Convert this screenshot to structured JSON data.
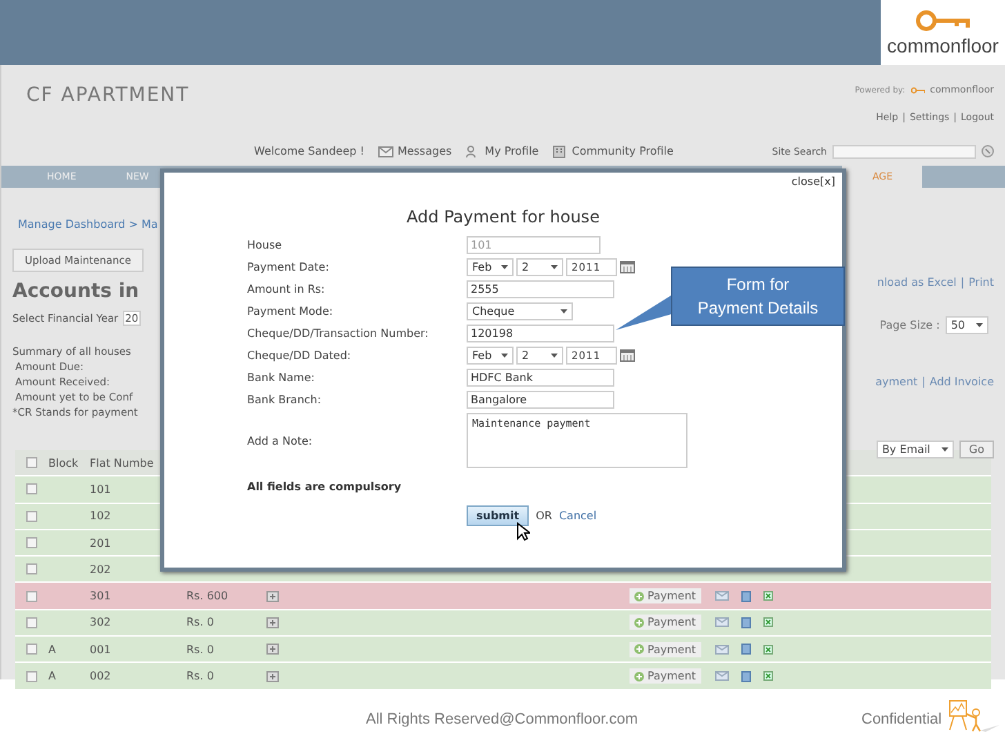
{
  "logo": {
    "text": "commonfloor"
  },
  "app": {
    "title": "CF APARTMENT",
    "powered_by": "Powered by:",
    "powered_logo": "commonfloor",
    "separator": "|",
    "top_links": [
      "Help",
      "Settings",
      "Logout"
    ],
    "welcome": "Welcome Sandeep !",
    "user_links": [
      {
        "label": "Messages",
        "kind": "envelope"
      },
      {
        "label": "My Profile",
        "kind": "person"
      },
      {
        "label": "Community Profile",
        "kind": "building"
      }
    ],
    "site_search": {
      "label": "Site Search"
    }
  },
  "nav": [
    {
      "label": "HOME",
      "selected": false
    },
    {
      "label": "NEW",
      "selected": false
    },
    {
      "label": "AGE",
      "selected": true
    }
  ],
  "breadcrumb": "Manage Dashboard > Ma",
  "upload_button": "Upload Maintenance",
  "heading": "Accounts in",
  "financial_year": {
    "label": "Select Financial Year",
    "value": "20"
  },
  "export_links": [
    "nload as Excel",
    "Print"
  ],
  "page_size": {
    "label": "Page Size :",
    "value": "50"
  },
  "action_links": [
    "ayment",
    "Add Invoice"
  ],
  "summary": [
    "Summary of all houses",
    "Amount Due:",
    "Amount Received:",
    "Amount yet to be Conf",
    "*CR Stands for payment"
  ],
  "bulk_action": {
    "value": "By Email",
    "button": "Go"
  },
  "table": {
    "columns": [
      "Block",
      "Flat Numbe"
    ],
    "header_checked": false,
    "rows": [
      {
        "block": "",
        "flat": "101",
        "due": false,
        "checked": false
      },
      {
        "block": "",
        "flat": "102",
        "due": false,
        "checked": false
      },
      {
        "block": "",
        "flat": "201",
        "due": false,
        "checked": false
      },
      {
        "block": "",
        "flat": "202",
        "due": false,
        "checked": false
      },
      {
        "block": "",
        "flat": "301",
        "amount": "Rs. 600",
        "payment": "Payment",
        "due": true,
        "checked": false
      },
      {
        "block": "",
        "flat": "302",
        "amount": "Rs. 0",
        "payment": "Payment",
        "due": false,
        "checked": false
      },
      {
        "block": "A",
        "flat": "001",
        "amount": "Rs. 0",
        "payment": "Payment",
        "due": false,
        "checked": false
      },
      {
        "block": "A",
        "flat": "002",
        "amount": "Rs. 0",
        "payment": "Payment",
        "due": false,
        "checked": false
      }
    ]
  },
  "dialog": {
    "close": "close[x]",
    "title": "Add Payment for house",
    "fields": [
      {
        "label": "House",
        "kind": "text",
        "value": "101",
        "disabled": true
      },
      {
        "label": "Payment Date:",
        "kind": "date",
        "month": "Feb",
        "day": "2",
        "year": "2011",
        "disabled": false
      },
      {
        "label": "Amount in Rs:",
        "kind": "text",
        "value": "2555",
        "disabled": false
      },
      {
        "label": "Payment Mode:",
        "kind": "select",
        "value": "Cheque",
        "disabled": false
      },
      {
        "label": "Cheque/DD/Transaction Number:",
        "kind": "text",
        "value": "120198",
        "disabled": false
      },
      {
        "label": "Cheque/DD Dated:",
        "kind": "date",
        "month": "Feb",
        "day": "2",
        "year": "2011",
        "disabled": false
      },
      {
        "label": "Bank Name:",
        "kind": "text",
        "value": "HDFC Bank",
        "disabled": false
      },
      {
        "label": "Bank Branch:",
        "kind": "text",
        "value": "Bangalore",
        "disabled": false
      },
      {
        "label": "Add a Note:",
        "kind": "textarea",
        "value": "Maintenance payment",
        "disabled": false
      }
    ],
    "note": "All fields are compulsory",
    "submit": "submit",
    "or": "OR",
    "cancel": "Cancel"
  },
  "callout": {
    "text": "Form for Payment Details"
  },
  "footer": {
    "copyright": "All Rights Reserved@Commonfloor.com",
    "label": "Confidential"
  }
}
